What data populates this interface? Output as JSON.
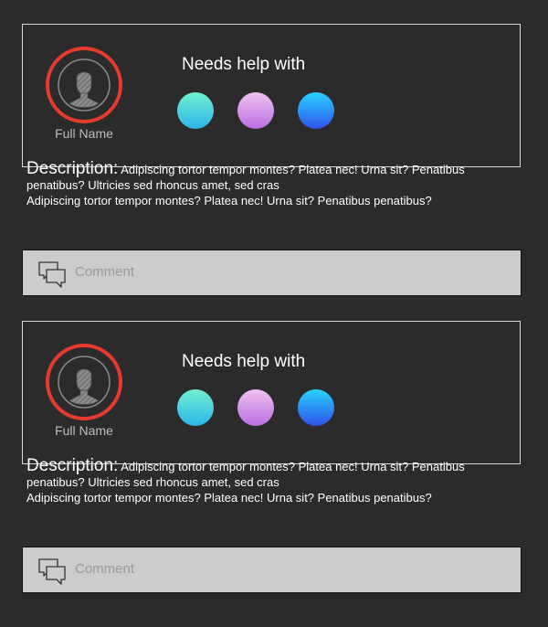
{
  "posts": [
    {
      "full_name": "Full Name",
      "needs_title": "Needs help with",
      "help_topics": [
        {
          "icon": "cyan-gradient-circle-icon",
          "colors": [
            "#72f0d0",
            "#2bb5ea"
          ]
        },
        {
          "icon": "purple-gradient-circle-icon",
          "colors": [
            "#f0c2f1",
            "#b96ee2"
          ]
        },
        {
          "icon": "blue-gradient-circle-icon",
          "colors": [
            "#28d3ff",
            "#2f52eb"
          ]
        }
      ],
      "description_label": "Description:",
      "description_text_1": "Adipiscing tortor tempor montes? Platea nec! Urna sit? Penatibus penatibus? Ultricies sed rhoncus amet, sed cras",
      "description_text_2": "Adipiscing tortor tempor montes? Platea nec! Urna sit? Penatibus penatibus?",
      "comment_placeholder": "Comment"
    },
    {
      "full_name": "Full Name",
      "needs_title": "Needs help with",
      "help_topics": [
        {
          "icon": "cyan-gradient-circle-icon",
          "colors": [
            "#72f0d0",
            "#2bb5ea"
          ]
        },
        {
          "icon": "purple-gradient-circle-icon",
          "colors": [
            "#f0c2f1",
            "#b96ee2"
          ]
        },
        {
          "icon": "blue-gradient-circle-icon",
          "colors": [
            "#28d3ff",
            "#2f52eb"
          ]
        }
      ],
      "description_label": "Description:",
      "description_text_1": "Adipiscing tortor tempor montes? Platea nec! Urna sit? Penatibus penatibus? Ultricies sed rhoncus amet, sed cras",
      "description_text_2": "Adipiscing tortor tempor montes? Platea nec! Urna sit? Penatibus penatibus?",
      "comment_placeholder": "Comment"
    }
  ],
  "colors": {
    "background": "#2b2b2b",
    "avatar_ring": "#e53a2c",
    "card_border": "#d8d8d8",
    "comment_bar": "#cccccc"
  }
}
